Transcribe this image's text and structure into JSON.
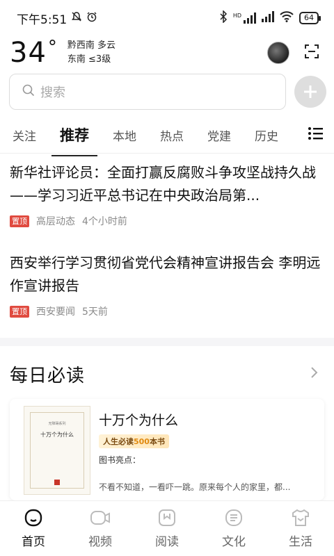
{
  "status_bar": {
    "time": "下午5:51",
    "hd": "HD",
    "battery": "64"
  },
  "weather": {
    "temp": "34",
    "unit": "°",
    "location_condition": "黔西南 多云",
    "wind": "东南 ≤3级"
  },
  "search": {
    "placeholder": "搜索"
  },
  "tabs": [
    {
      "label": "关注"
    },
    {
      "label": "推荐",
      "active": true
    },
    {
      "label": "本地"
    },
    {
      "label": "热点"
    },
    {
      "label": "党建"
    },
    {
      "label": "历史"
    }
  ],
  "news": [
    {
      "title": "新华社评论员：全面打赢反腐败斗争攻坚战持久战——学习习近平总书记在中央政治局第...",
      "badge": "置顶",
      "source": "高层动态",
      "time": "4个小时前"
    },
    {
      "title": "西安举行学习贯彻省党代会精神宣讲报告会 李明远作宣讲报告",
      "badge": "置顶",
      "source": "西安要闻",
      "time": "5天前"
    }
  ],
  "daily": {
    "title": "每日必读",
    "book": {
      "name": "十万个为什么",
      "tag_prefix": "人生必读",
      "tag_number": "500",
      "tag_suffix": "本书",
      "highlight_label": "图书亮点：",
      "description": "不看不知道，一看吓一跳。原来每个人的家里，都...",
      "cover_series": "无障碍系列",
      "cover_title": "十万个为什么"
    }
  },
  "bottom_nav": [
    {
      "label": "首页",
      "active": true
    },
    {
      "label": "视频"
    },
    {
      "label": "阅读"
    },
    {
      "label": "文化"
    },
    {
      "label": "生活"
    }
  ]
}
